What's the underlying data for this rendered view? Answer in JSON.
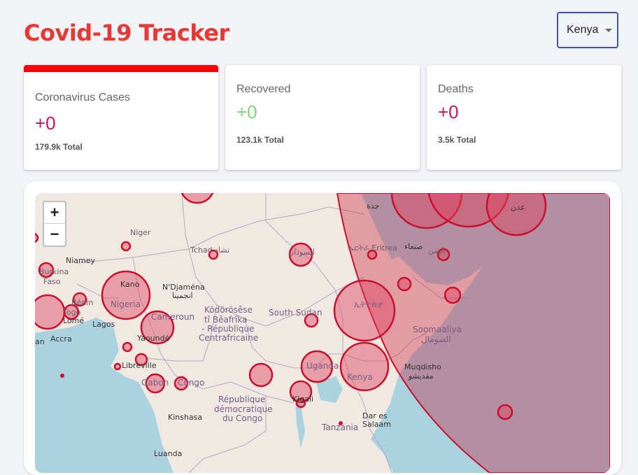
{
  "app": {
    "title": "Covid-19 Tracker"
  },
  "country_select": {
    "value": "Kenya"
  },
  "stats": {
    "cases": {
      "label": "Coronavirus Cases",
      "value": "+0",
      "total": "179.9k Total",
      "color": "#c2185b"
    },
    "recovered": {
      "label": "Recovered",
      "value": "+0",
      "total": "123.1k Total",
      "color": "#7dd87d"
    },
    "deaths": {
      "label": "Deaths",
      "value": "+0",
      "total": "3.5k Total",
      "color": "#c2185b"
    }
  },
  "map": {
    "zoom_in": "+",
    "zoom_out": "−",
    "labels": {
      "niger": "Niger",
      "tchad": "Tchad تشاد",
      "sudan": "السودان",
      "eritrea": "ኤርትራ Eritrea",
      "sanaa": "صنعاء",
      "yemen": "اليمن",
      "jeddah": "جدة",
      "aden": "عدن",
      "niamey": "Niamey",
      "burkina": "Burkina",
      "faso": "Faso",
      "kano": "Kano",
      "ndjamena": "N'Djaména",
      "ndjamena_ar": "انجمينا",
      "nigeria": "Nigeria",
      "benin": "Bénin",
      "togo": "Togo",
      "lome": "Lomé",
      "lagos": "Lagos",
      "accra": "Accra",
      "an": "an",
      "cameroun": "Cameroun",
      "yaounde": "Yaoundé",
      "car1": "Ködörösêse",
      "car2": "tî Bêafrîka",
      "car3": "- République",
      "car4": "Centrafricaine",
      "south_sudan": "South Sudan",
      "ethiopia": "ኢትዮጵያ",
      "somalia1": "Soomaaliya",
      "somalia2": "الصومال",
      "mogadishu1": "Muqdisho",
      "mogadishu2": "مقديشو",
      "libreville": "Libreville",
      "gabon": "Gabon",
      "congo": "Congo",
      "uganda": "Uganda",
      "kenya": "Kenya",
      "kigali": "Kigali",
      "drc1": "République",
      "drc2": "démocratique",
      "drc3": "du Congo",
      "kinshasa": "Kinshasa",
      "dar1": "Dar es",
      "dar2": "Salaam",
      "tanzania": "Tanzania",
      "luanda": "Luanda"
    },
    "colors": {
      "circle_fill": "#e0435f",
      "circle_stroke": "#c8102e",
      "ocean": "#aad3df",
      "land": "#efe9e1"
    }
  }
}
